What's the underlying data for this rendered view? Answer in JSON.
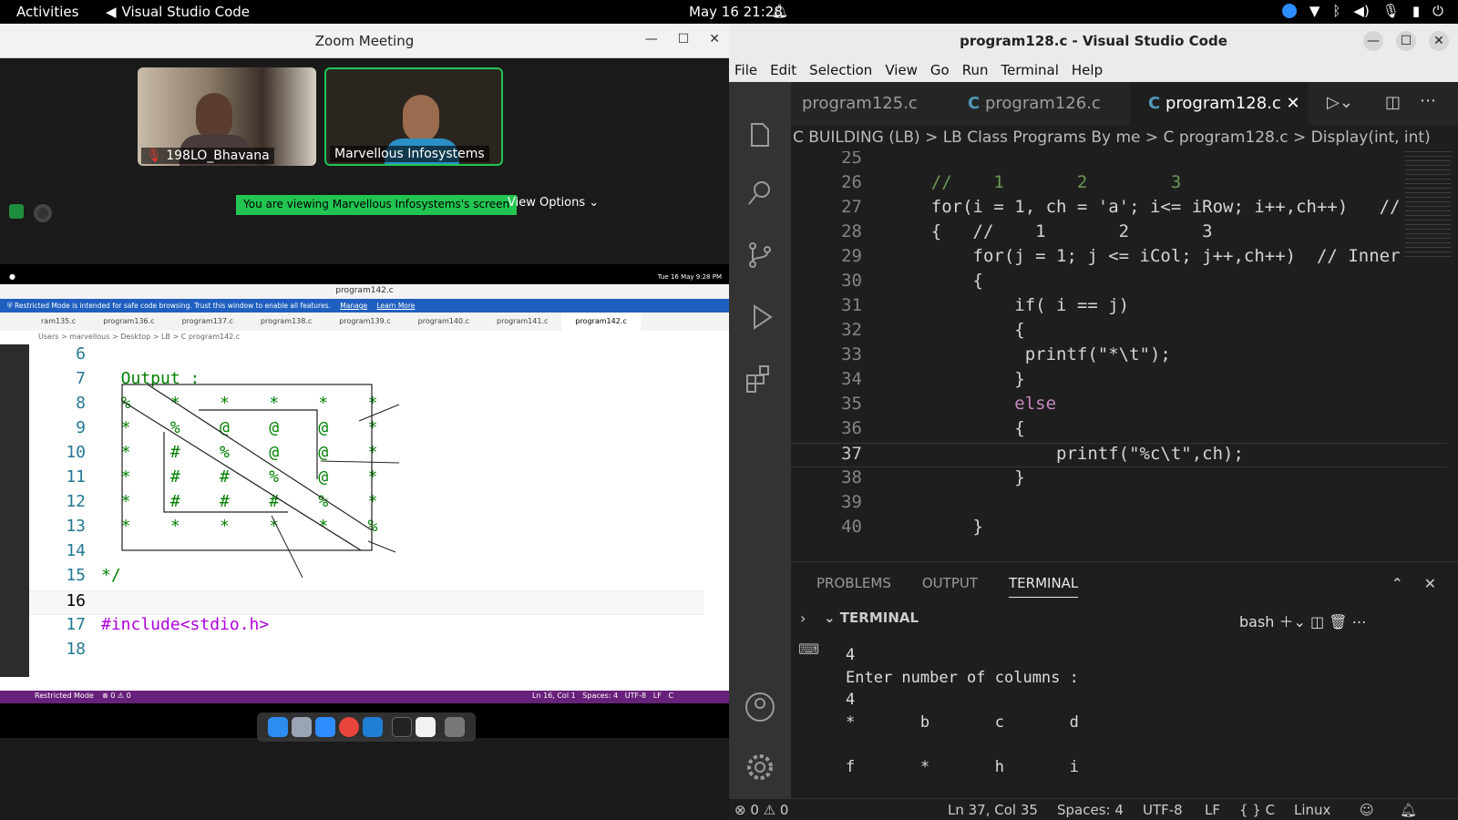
{
  "topbar": {
    "activities": "Activities",
    "app": "Visual Studio Code",
    "clock": "May 16  21:28"
  },
  "zoom": {
    "title": "Zoom Meeting",
    "participants": [
      {
        "name": "198LO_Bhavana"
      },
      {
        "name": "Marvellous Infosystems"
      }
    ],
    "viewing": "You are viewing Marvellous Infosystems's screen",
    "view_options": "View Options"
  },
  "shared": {
    "mac_clock": "Tue 16 May  9:28 PM",
    "title": "program142.c",
    "restricted": "Restricted Mode is intended for safe code browsing. Trust this window to enable all features.",
    "manage": "Manage",
    "learn": "Learn More",
    "tabs": [
      "ram135.c",
      "program136.c",
      "program137.c",
      "program138.c",
      "program139.c",
      "program140.c",
      "program141.c",
      "program142.c"
    ],
    "breadcrumb": "Users > marvellous > Desktop > LB > C program142.c",
    "lines": [
      {
        "n": "6",
        "c": ""
      },
      {
        "n": "7",
        "c": "  Output :"
      },
      {
        "n": "8",
        "c": "  %    *    *    *    *    *"
      },
      {
        "n": "9",
        "c": "  *    %    @    @    @    *"
      },
      {
        "n": "10",
        "c": "  *    #    %    @    @    *"
      },
      {
        "n": "11",
        "c": "  *    #    #    %    @    *"
      },
      {
        "n": "12",
        "c": "  *    #    #    #    %    *"
      },
      {
        "n": "13",
        "c": "  *    *    *    *    *    %"
      },
      {
        "n": "14",
        "c": ""
      },
      {
        "n": "15",
        "c": "*/"
      },
      {
        "n": "16",
        "c": ""
      },
      {
        "n": "17",
        "c": "#include<stdio.h>"
      },
      {
        "n": "18",
        "c": ""
      }
    ],
    "status_left": "Restricted Mode",
    "status_errors": "⊗ 0 ⚠ 0",
    "status_right": "Ln 16, Col 1   Spaces: 4   UTF-8   LF   C"
  },
  "vscode": {
    "title": "program128.c - Visual Studio Code",
    "menu": [
      "File",
      "Edit",
      "Selection",
      "View",
      "Go",
      "Run",
      "Terminal",
      "Help"
    ],
    "tabs": [
      "program125.c",
      "program126.c",
      "program128.c"
    ],
    "breadcrumb": "C BUILDING (LB) > LB Class Programs By me > C program128.c > Display(int, int)",
    "lines": [
      {
        "n": "25",
        "c": ""
      },
      {
        "n": "26",
        "c": "    //    1       2        3"
      },
      {
        "n": "27",
        "c": "    for(i = 1, ch = 'a'; i<= iRow; i++,ch++)   //"
      },
      {
        "n": "28",
        "c": "    {   //    1       2       3"
      },
      {
        "n": "29",
        "c": "        for(j = 1; j <= iCol; j++,ch++)  // Inner"
      },
      {
        "n": "30",
        "c": "        {"
      },
      {
        "n": "31",
        "c": "            if( i == j)"
      },
      {
        "n": "32",
        "c": "            {"
      },
      {
        "n": "33",
        "c": "             printf(\"*\\t\");"
      },
      {
        "n": "34",
        "c": "            }"
      },
      {
        "n": "35",
        "c": "            else"
      },
      {
        "n": "36",
        "c": "            {"
      },
      {
        "n": "37",
        "c": "                printf(\"%c\\t\",ch);"
      },
      {
        "n": "38",
        "c": "            }"
      },
      {
        "n": "39",
        "c": ""
      },
      {
        "n": "40",
        "c": "        }"
      }
    ],
    "panel_tabs": [
      "PROBLEMS",
      "OUTPUT",
      "TERMINAL"
    ],
    "terminal_label": "TERMINAL",
    "shell": "bash",
    "terminal_output": "4\nEnter number of columns :\n4\n*       b       c       d\n\nf       *       h       i",
    "status": {
      "errors": "⊗ 0 ⚠ 0",
      "pos": "Ln 37, Col 35",
      "spaces": "Spaces: 4",
      "enc": "UTF-8",
      "eol": "LF",
      "lang": "{ } C",
      "os": "Linux"
    }
  }
}
